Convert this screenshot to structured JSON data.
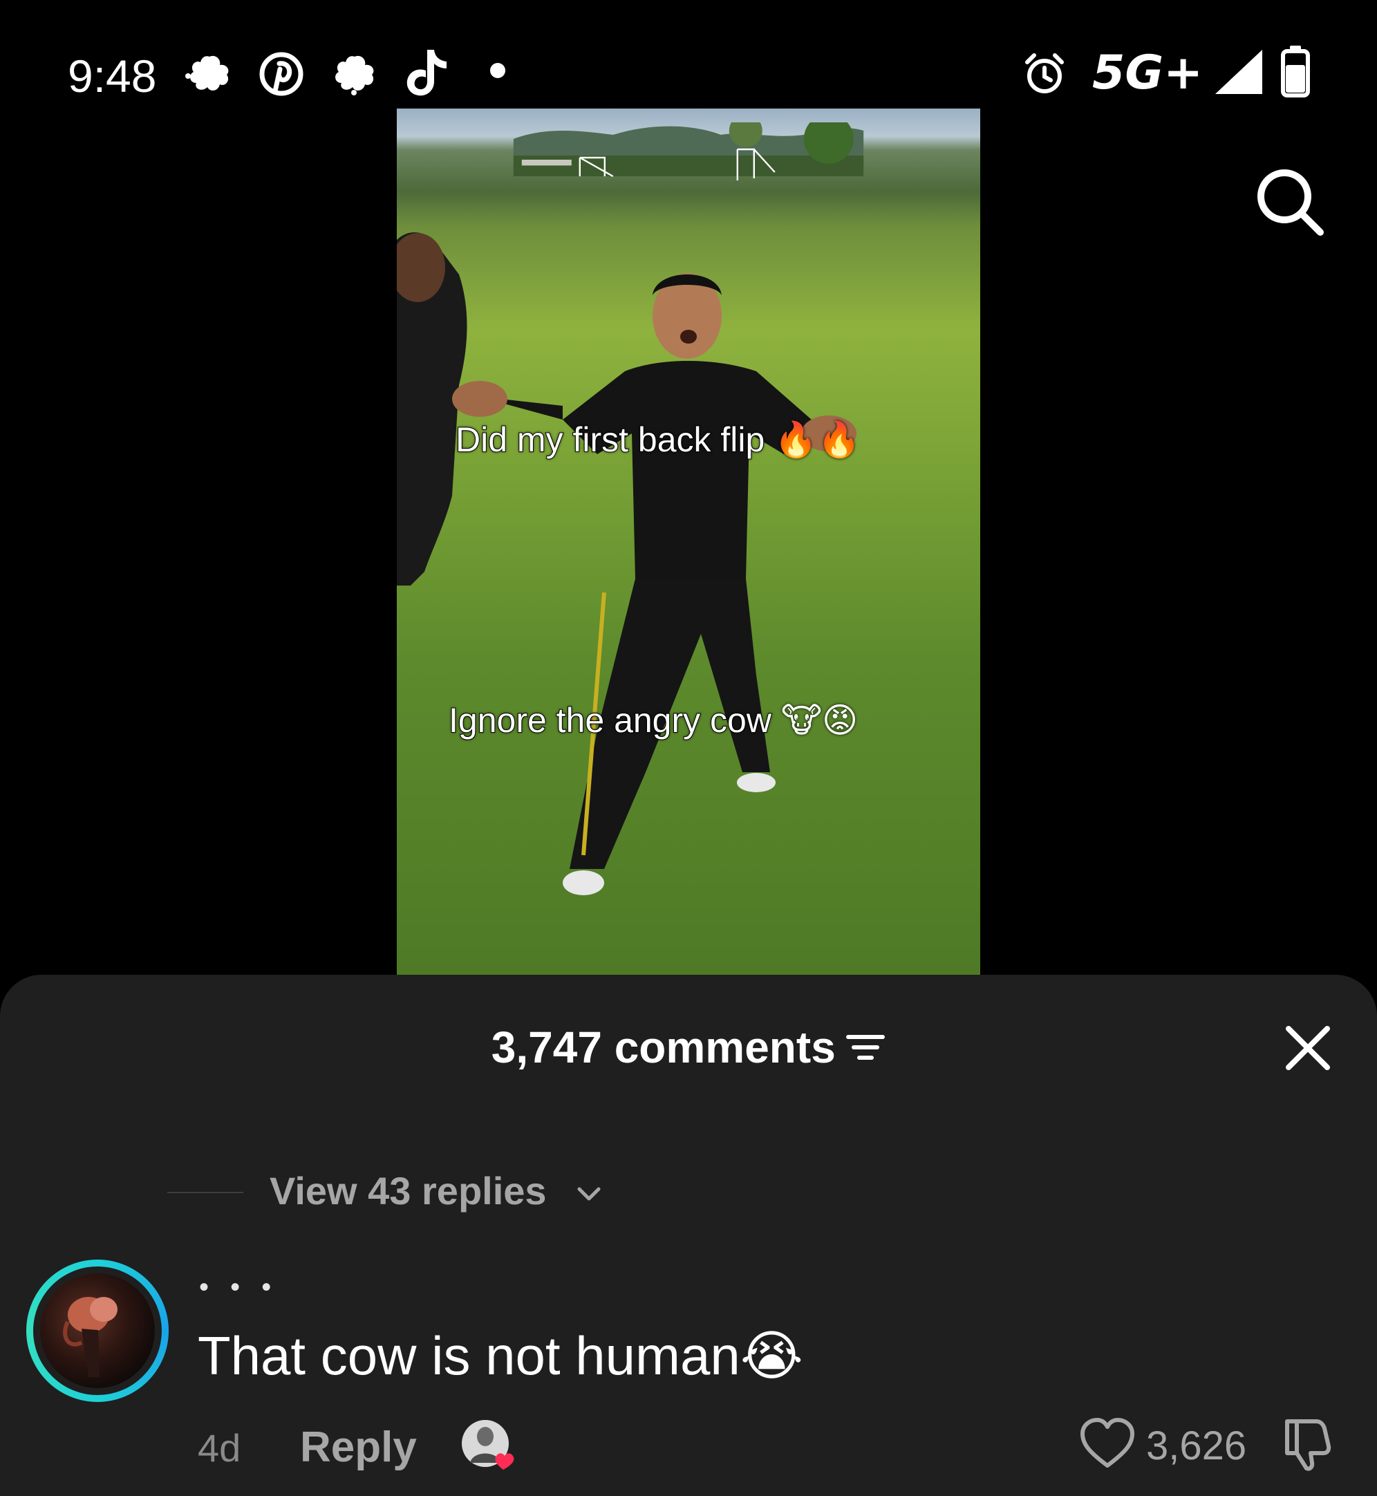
{
  "status_bar": {
    "time": "9:48",
    "network": "5G+",
    "icons": [
      "notification-blob-icon",
      "pinterest-icon",
      "notification-blob-icon",
      "tiktok-icon",
      "dot-icon",
      "alarm-icon",
      "signal-icon",
      "battery-icon"
    ]
  },
  "video": {
    "caption_top": "Did my first back flip",
    "caption_top_emoji": "🔥🔥",
    "caption_bottom": "Ignore the angry cow",
    "caption_bottom_emoji": "🐮😡"
  },
  "comments_sheet": {
    "title": "3,747 comments",
    "view_replies": "View 43 replies",
    "comment": {
      "username": "• • •",
      "text": "That cow is not human",
      "emoji": "😭",
      "age": "4d",
      "reply_label": "Reply",
      "like_count": "3,626"
    }
  },
  "colors": {
    "sheet_background": "#1f1f1f",
    "avatar_ring": "#1fd1d8",
    "muted_text": "#a6a6a6",
    "creator_heart": "#ff2d55"
  }
}
